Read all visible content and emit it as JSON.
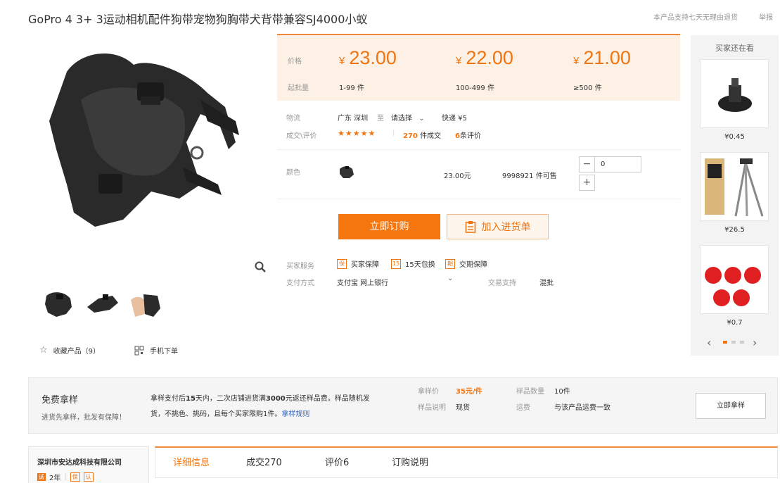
{
  "title": "GoPro 4 3+ 3运动相机配件狗带宠物狗胸带犬背带兼容SJ4000小蚁",
  "top_notice": "本产品支持七天无理由退货",
  "report": "举报",
  "actions": {
    "favorite": "收藏产品（9）",
    "mobile_order": "手机下单"
  },
  "price_box": {
    "price_label": "价格",
    "moq_label": "起批量",
    "currency": "¥",
    "tiers": [
      {
        "price": "23.00",
        "range": "1-99 件"
      },
      {
        "price": "22.00",
        "range": "100-499 件"
      },
      {
        "price": "21.00",
        "range": "≥500 件"
      }
    ]
  },
  "logistics": {
    "label": "物流",
    "from": "广东 深圳",
    "to_word": "至",
    "select": "请选择",
    "shipping": "快递 ¥5"
  },
  "reviews": {
    "label": "成交\\评价",
    "stars": "★★★★★",
    "deals_count": "270",
    "deals_word": "件成交",
    "review_count": "6",
    "review_word": "条评价"
  },
  "variant": {
    "label": "颜色",
    "price": "23.00元",
    "stock": "9998921 件可售",
    "qty_value": "0"
  },
  "buttons": {
    "buy_now": "立即订购",
    "add_cart": "加入进货单"
  },
  "services": {
    "label": "买家服务",
    "items": [
      {
        "icon_text": "保",
        "label": "买家保障"
      },
      {
        "icon_text": "15",
        "label": "15天包换"
      },
      {
        "icon_text": "期",
        "label": "交期保障"
      }
    ]
  },
  "payment": {
    "label": "支付方式",
    "value": "支付宝  网上银行",
    "trade_label": "交易支持",
    "trade_value": "混批"
  },
  "sidebar": {
    "title": "买家还在看",
    "items": [
      {
        "price": "¥0.45"
      },
      {
        "price": "¥26.5"
      },
      {
        "price": "¥0.7"
      }
    ]
  },
  "sample": {
    "title": "免费拿样",
    "subtitle": "进货先拿样，批发有保障！",
    "desc_a": "拿样支付后",
    "desc_b": "15",
    "desc_c": "天内，二次店铺进货满",
    "desc_d": "3000",
    "desc_e": "元返还样品费。样品随机发货，不挑色、挑码，且每个买家限购1件。",
    "rules_link": "拿样规则",
    "price_label": "拿样价",
    "price_value": "35元/件",
    "qty_label": "样品数量",
    "qty_value": "10件",
    "note_label": "样品说明",
    "note_value": "现货",
    "fee_label": "运费",
    "fee_value": "与该产品运费一致",
    "button": "立即拿样"
  },
  "company": {
    "name": "深圳市安达成科技有限公司",
    "years": "2年"
  },
  "tabs": [
    "详细信息",
    "成交270",
    "评价6",
    "订购说明"
  ],
  "colors": {
    "accent": "#f5760f",
    "price_bg": "#fdf1e6"
  }
}
